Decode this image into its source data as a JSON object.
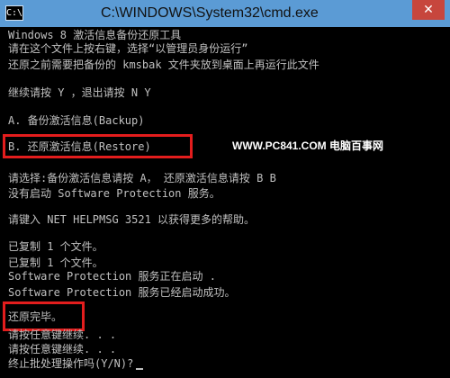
{
  "window": {
    "title": "C:\\WINDOWS\\System32\\cmd.exe",
    "app_icon": "C:\\",
    "close_glyph": "✕"
  },
  "console": {
    "lines": [
      "Windows 8 激活信息备份还原工具",
      "请在这个文件上按右键，选择“以管理员身份运行”",
      "还原之前需要把备份的 kmsbak 文件夹放到桌面上再运行此文件",
      "继续请按 Y ，退出请按 N Y",
      "A. 备份激活信息(Backup)",
      "B. 还原激活信息(Restore)",
      "请选择:备份激活信息请按 A， 还原激活信息请按 B B",
      "没有启动 Software Protection 服务。",
      "请键入 NET HELPMSG 3521 以获得更多的帮助。",
      "已复制         1 个文件。",
      "已复制         1 个文件。",
      "Software Protection 服务正在启动 .",
      "Software Protection 服务已经启动成功。",
      "还原完毕。",
      "请按任意键继续. . .",
      "请按任意键继续. . .",
      "终止批处理操作吗(Y/N)?"
    ]
  },
  "watermark": "WWW.PC841.COM 电脑百事网",
  "colors": {
    "titlebar": "#5b9bd5",
    "console_bg": "#000000",
    "console_text": "#c0c0c0",
    "highlight_box": "#e31d1d",
    "close_button": "#c7463d"
  }
}
